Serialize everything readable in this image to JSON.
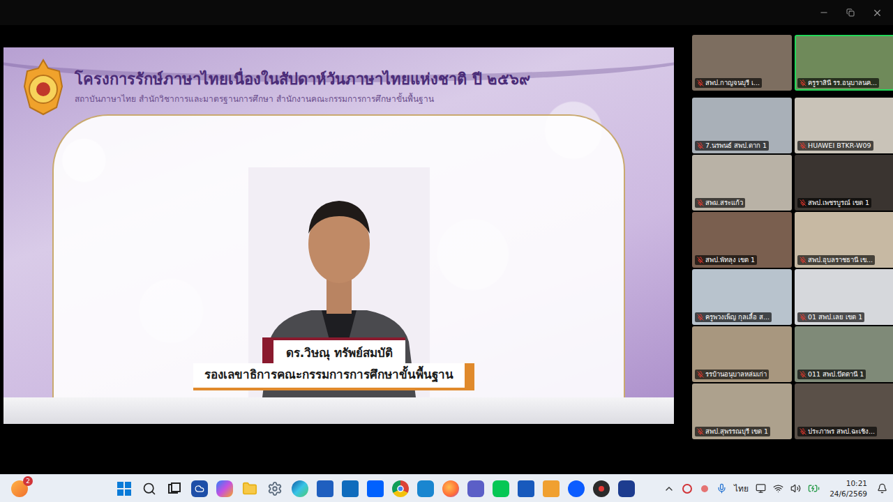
{
  "presentation": {
    "title": "โครงการรักษ์ภาษาไทยเนื่องในสัปดาห์วันภาษาไทยแห่งชาติ ปี ๒๕๖๙",
    "subtitle": "สถาบันภาษาไทย สำนักวิชาการและมาตรฐานการศึกษา สำนักงานคณะกรรมการการศึกษาขั้นพื้นฐาน",
    "speaker_name": "ดร.วิษณุ ทรัพย์สมบัติ",
    "speaker_role": "รองเลขาธิการคณะกรรมการการศึกษาขั้นพื้นฐาน"
  },
  "participants": [
    {
      "name": "สพป.กาญจนบุรี เ...",
      "muted": true,
      "speaking": false,
      "color": "#7d6e60"
    },
    {
      "name": "ครูราสินี รร.อนุบาลนค...",
      "muted": true,
      "speaking": true,
      "color": "#6f8a5a"
    },
    {
      "name": "7.นรพนธ์ สพป.ตาก 1",
      "muted": true,
      "speaking": false,
      "color": "#a9b0b8"
    },
    {
      "name": "HUAWEI BTKR-W09",
      "muted": true,
      "speaking": false,
      "color": "#c9c3b8"
    },
    {
      "name": "สพม.สระแก้ว",
      "muted": true,
      "speaking": false,
      "color": "#b9b2a6"
    },
    {
      "name": "สพป.เพชรบูรณ์ เขต 1",
      "muted": true,
      "speaking": false,
      "color": "#3a3430"
    },
    {
      "name": "สพป.พัทลุง เขต 1",
      "muted": true,
      "speaking": false,
      "color": "#7a5f4f"
    },
    {
      "name": "สพป.อุบลราชธานี เข...",
      "muted": true,
      "speaking": false,
      "color": "#c7b9a3"
    },
    {
      "name": "ครูพวงเพ็ญ กุลเลื้อ ส...",
      "muted": true,
      "speaking": false,
      "color": "#b8c3cd"
    },
    {
      "name": "01 สพป.เลย เขต 1",
      "muted": true,
      "speaking": false,
      "color": "#d6d8dc"
    },
    {
      "name": "รรบ้านอนุบาลหล่มเก่า",
      "muted": true,
      "speaking": false,
      "color": "#a8977f"
    },
    {
      "name": "011 สพป.ปัตตานี 1",
      "muted": true,
      "speaking": false,
      "color": "#7f8a78"
    },
    {
      "name": "สพป.สุพรรณบุรี เขต 1",
      "muted": true,
      "speaking": false,
      "color": "#ada18d"
    },
    {
      "name": "ประภาพร สพป.ฉะเชิง...",
      "muted": true,
      "speaking": false,
      "color": "#5a5048"
    }
  ],
  "taskbar": {
    "notification_badge": "2",
    "language": "ไทย",
    "time": "10:21",
    "date": "24/6/2569"
  }
}
